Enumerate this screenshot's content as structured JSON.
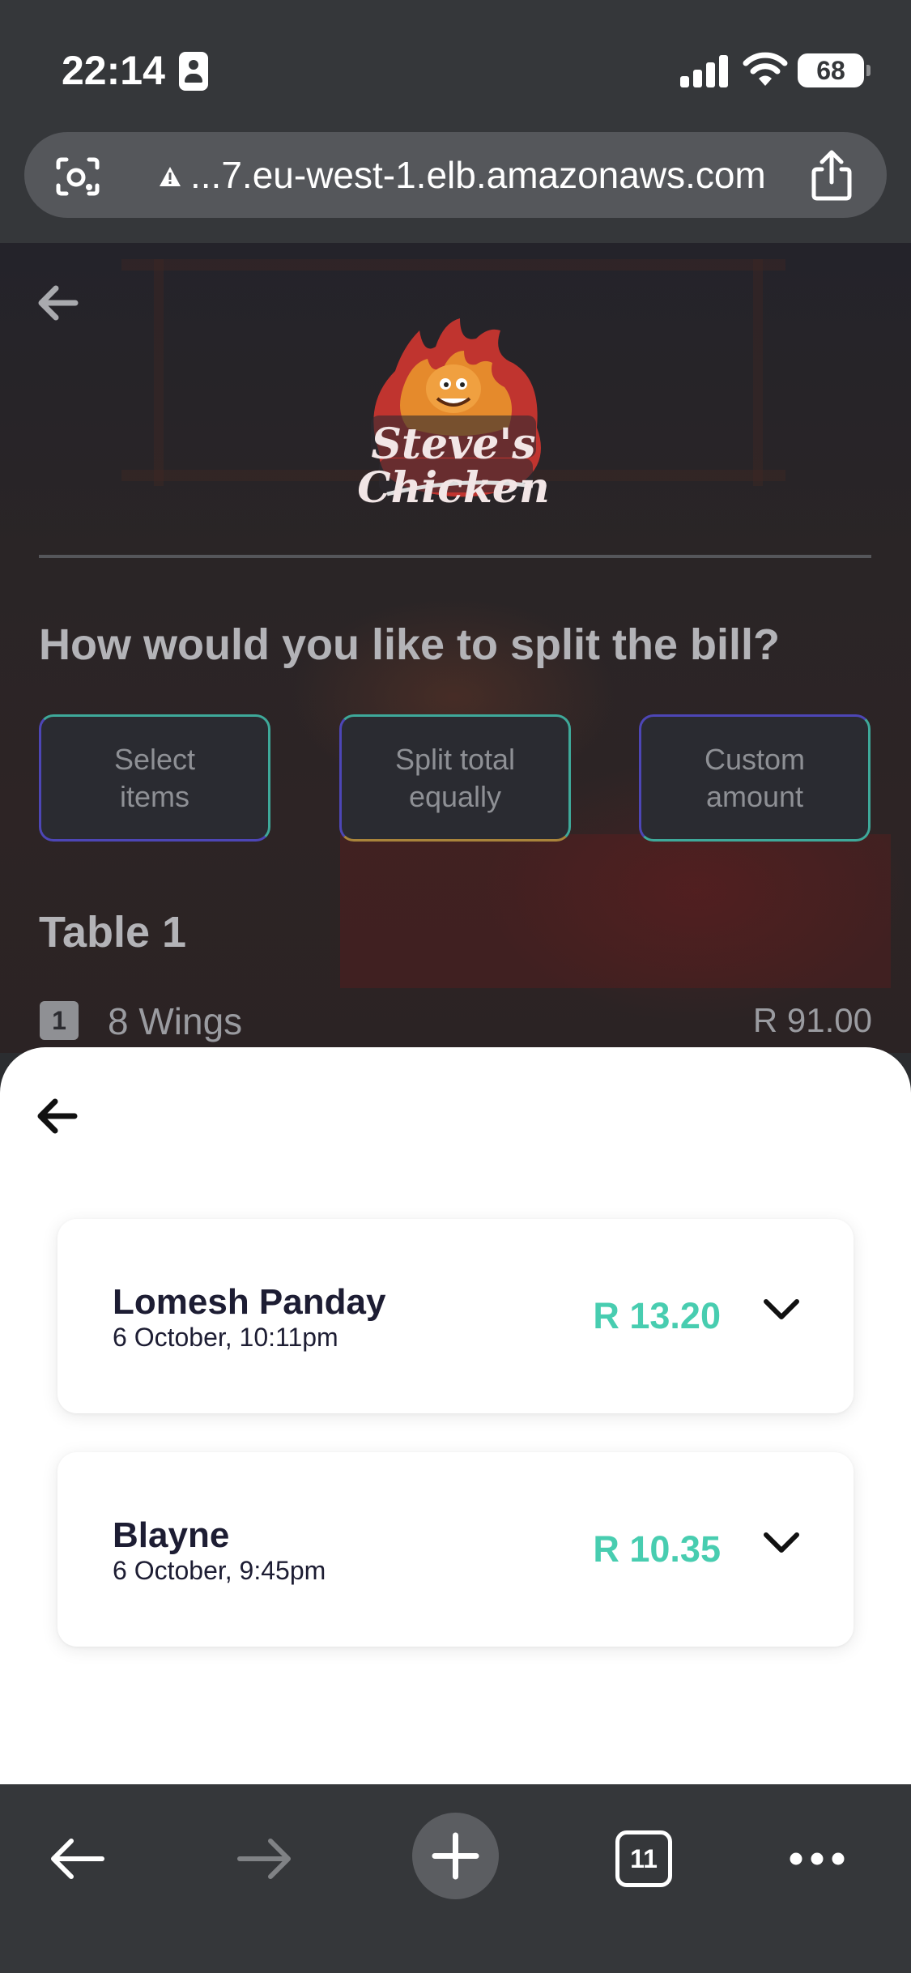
{
  "status_bar": {
    "time": "22:14",
    "battery": "68",
    "icons": [
      "contact-card-icon",
      "cellular-signal-icon",
      "wifi-icon",
      "battery-icon"
    ]
  },
  "browser": {
    "url": "...7.eu-west-1.elb.amazonaws.com",
    "icons": [
      "lens-icon",
      "warning-icon",
      "share-icon"
    ],
    "toolbar": {
      "tab_count": "11",
      "icons": [
        "back-arrow-icon",
        "forward-arrow-icon",
        "plus-icon",
        "tabs-icon",
        "more-icon"
      ]
    }
  },
  "restaurant": {
    "brand": "Steve's Chicken",
    "question": "How would you like to split the bill?",
    "split_options": [
      {
        "line1": "Select",
        "line2": "items"
      },
      {
        "line1": "Split total",
        "line2": "equally"
      },
      {
        "line1": "Custom",
        "line2": "amount"
      }
    ],
    "table": {
      "title": "Table 1",
      "items": [
        {
          "qty": "1",
          "name": "8 Wings",
          "price": "R 91.00"
        }
      ]
    }
  },
  "payments_sheet": {
    "payments": [
      {
        "name": "Lomesh Panday",
        "date": "6 October, 10:11pm",
        "amount": "R 13.20"
      },
      {
        "name": "Blayne",
        "date": "6 October, 9:45pm",
        "amount": "R 10.35"
      }
    ]
  },
  "colors": {
    "accent_teal": "#48cdb0",
    "dark_text": "#1d1d33",
    "browser_chrome": "#35373a"
  }
}
